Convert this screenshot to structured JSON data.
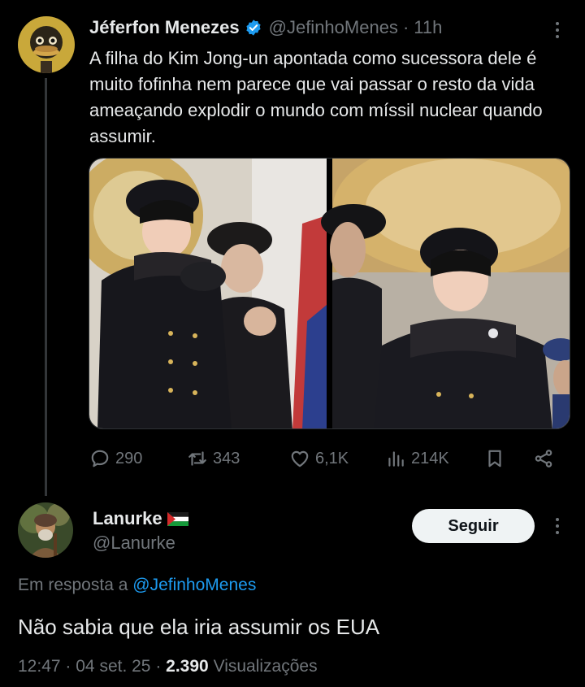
{
  "tweet": {
    "author_name": "Jéferfon Menezes",
    "author_handle": "@JefinhoMenes",
    "separator": "·",
    "time": "11h",
    "text": "A filha do Kim Jong-un apontada como sucessora dele é muito fofinha nem parece que vai passar o resto da vida ameaçando explodir o mundo com míssil nuclear quando assumir.",
    "avatar_icon": "ostrich-avatar",
    "verified_icon": "verified-badge-icon",
    "stats": {
      "replies": "290",
      "retweets": "343",
      "likes": "6,1K",
      "views": "214K"
    }
  },
  "reply": {
    "author_name": "Lanurke",
    "author_handle": "@Lanurke",
    "flag_icon": "palestine-flag-icon",
    "follow_label": "Seguir",
    "in_reply_prefix": "Em resposta a",
    "in_reply_handle": "@JefinhoMenes",
    "text": "Não sabia que ela iria assumir os EUA",
    "time": "12:47",
    "date": "04 set. 25",
    "views_count": "2.390",
    "views_label": "Visualizações",
    "dot": "·"
  },
  "colors": {
    "background": "#000000",
    "text": "#e7e9ea",
    "muted": "#71767b",
    "accent": "#1d9bf0"
  }
}
